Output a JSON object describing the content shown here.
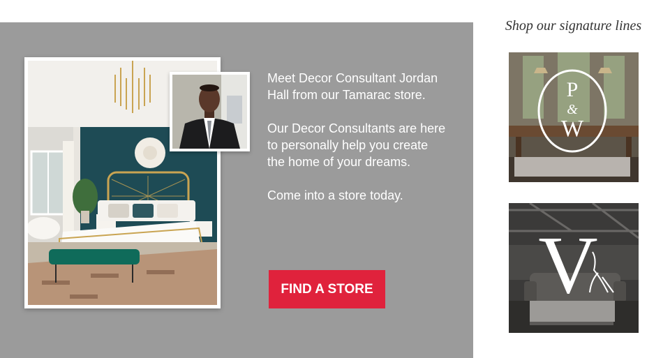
{
  "promo": {
    "paragraphs": [
      "Meet Decor Consultant Jordan Hall from our Tamarac store.",
      "Our Decor Consultants are here to personally help you create the home of your dreams.",
      "Come into a store today."
    ],
    "cta_label": "FIND A STORE",
    "colors": {
      "panel": "#9b9b9b",
      "cta": "#e0223c"
    }
  },
  "signature": {
    "heading": "Shop our signature lines",
    "brands": [
      {
        "logo_letters": [
          "P",
          "&",
          "W"
        ]
      },
      {
        "logo_letters": [
          "V"
        ]
      }
    ]
  },
  "icons": [
    "pw-brand-logo-icon",
    "v-brand-logo-icon"
  ]
}
